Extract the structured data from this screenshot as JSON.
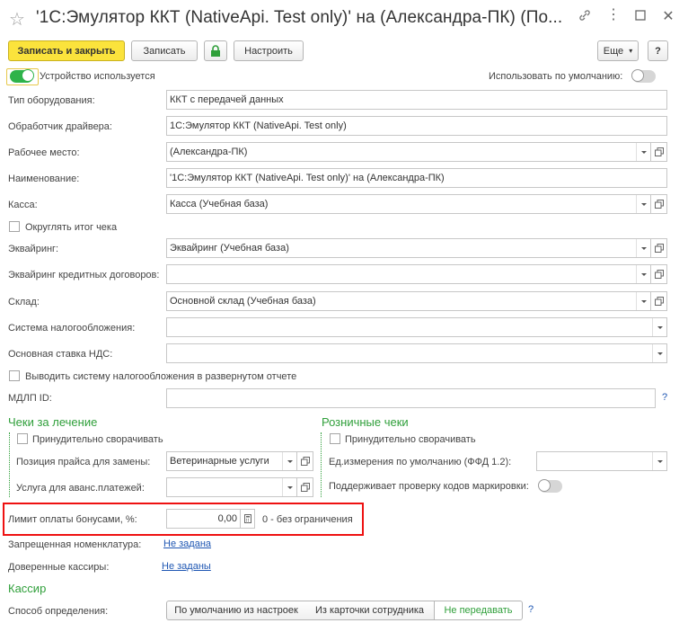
{
  "window": {
    "title": "'1С:Эмулятор ККТ (NativeApi. Test only)' на (Александра-ПК) (По...",
    "buttons": [
      "link-icon",
      "more-icon",
      "maximize-icon",
      "close-icon"
    ]
  },
  "toolbar": {
    "save_close": "Записать и закрыть",
    "save": "Записать",
    "settings": "Настроить",
    "more": "Еще",
    "help": "?"
  },
  "device_used": {
    "label": "Устройство используется",
    "on": true
  },
  "default_use": {
    "label": "Использовать по умолчанию:",
    "on": false
  },
  "fields": {
    "equipment_type": {
      "label": "Тип оборудования:",
      "value": "ККТ с передачей данных"
    },
    "driver": {
      "label": "Обработчик драйвера:",
      "value": "1С:Эмулятор ККТ (NativeApi. Test only)"
    },
    "workplace": {
      "label": "Рабочее место:",
      "value": "(Александра-ПК)"
    },
    "name": {
      "label": "Наименование:",
      "value": "'1С:Эмулятор ККТ (NativeApi. Test only)' на (Александра-ПК)"
    },
    "cashbox": {
      "label": "Касса:",
      "value": "Касса (Учебная база)"
    },
    "round_total": {
      "label": "Округлять итог чека",
      "checked": false
    },
    "acquiring": {
      "label": "Эквайринг:",
      "value": "Эквайринг (Учебная база)"
    },
    "acquiring_credit": {
      "label": "Эквайринг кредитных договоров:",
      "value": ""
    },
    "warehouse": {
      "label": "Склад:",
      "value": "Основной склад (Учебная база)"
    },
    "tax_system": {
      "label": "Система налогообложения:",
      "value": ""
    },
    "vat_rate": {
      "label": "Основная ставка НДС:",
      "value": ""
    },
    "show_tax_extended": {
      "label": "Выводить систему налогообложения в развернутом отчете",
      "checked": false
    },
    "mdlp": {
      "label": "МДЛП ID:",
      "value": "",
      "help": "?"
    }
  },
  "treatment": {
    "title": "Чеки за лечение",
    "force_collapse": {
      "label": "Принудительно сворачивать",
      "checked": false
    },
    "price_position": {
      "label": "Позиция прайса для замены:",
      "value": "Ветеринарные услуги"
    },
    "advance_service": {
      "label": "Услуга для аванс.платежей:",
      "value": ""
    }
  },
  "retail": {
    "title": "Розничные чеки",
    "force_collapse": {
      "label": "Принудительно сворачивать",
      "checked": false
    },
    "unit_default": {
      "label": "Ед.измерения по умолчанию (ФФД 1.2):",
      "value": ""
    },
    "marking_check": {
      "label": "Поддерживает проверку кодов маркировки:",
      "on": false
    }
  },
  "bonus_limit": {
    "label": "Лимит оплаты бонусами, %:",
    "value": "0,00",
    "hint": "0 - без ограничения"
  },
  "forbidden": {
    "label": "Запрещенная номенклатура:",
    "link": "Не задана"
  },
  "trusted": {
    "label": "Доверенные кассиры:",
    "link": "Не заданы"
  },
  "cashier": {
    "title": "Кассир",
    "method_label": "Способ определения:",
    "options": [
      "По умолчанию из настроек",
      "Из карточки сотрудника",
      "Не передавать"
    ],
    "selected": "Не передавать",
    "help": "?"
  },
  "colors": {
    "accent": "#2f9f3a",
    "primary_btn": "#fbe33c",
    "link": "#1f57b3",
    "highlight": "#e11111"
  }
}
